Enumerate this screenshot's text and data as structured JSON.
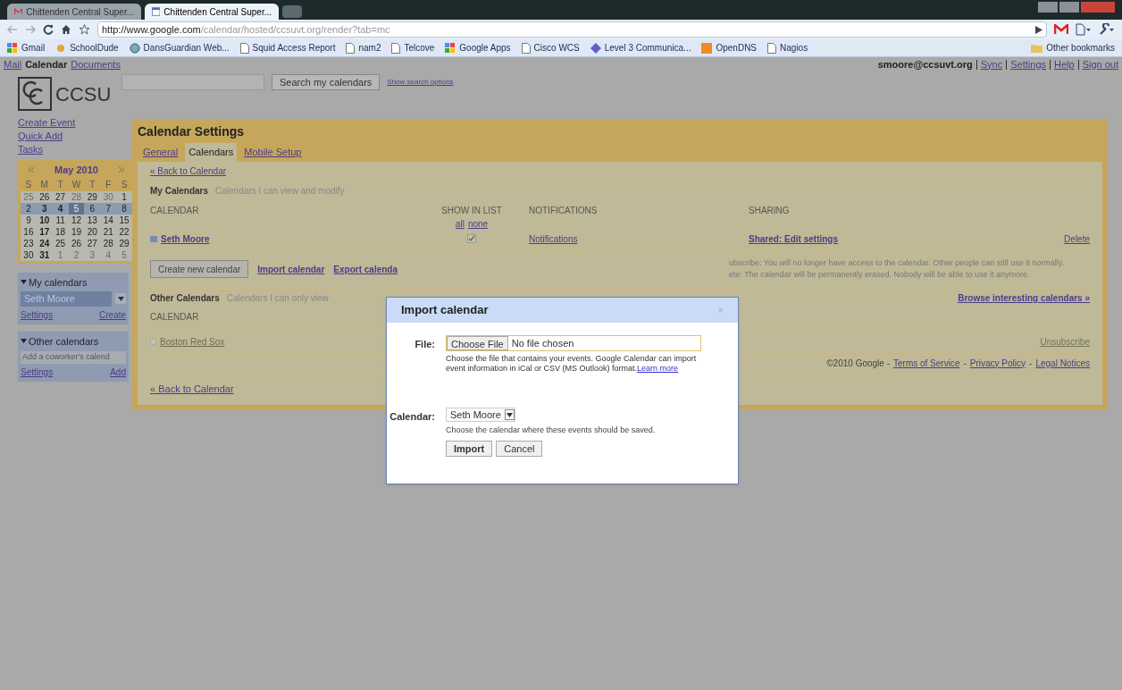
{
  "browser": {
    "tabs": [
      {
        "label": "Chittenden Central Super...",
        "selected": false
      },
      {
        "label": "Chittenden Central Super...",
        "selected": true
      }
    ],
    "url": {
      "host": "http://www.google.com",
      "path": "/calendar/hosted/ccsuvt.org/render?tab=mc"
    },
    "bookmarks": [
      "Gmail",
      "SchoolDude",
      "DansGuardian Web...",
      "Squid Access Report",
      "nam2",
      "Telcove",
      "Google Apps",
      "Cisco WCS",
      "Level 3 Communica...",
      "OpenDNS",
      "Nagios"
    ],
    "other_bookmarks": "Other bookmarks"
  },
  "topbar": {
    "apps": [
      {
        "label": "Mail",
        "selected": false
      },
      {
        "label": "Calendar",
        "selected": true
      },
      {
        "label": "Documents",
        "selected": false
      }
    ],
    "user": "smoore@ccsuvt.org",
    "links": [
      "Sync",
      "Settings",
      "Help",
      "Sign out"
    ]
  },
  "logo": "CCSU",
  "search_button": "Search my calendars",
  "search_options": "Show search options",
  "sidebar": {
    "links": [
      "Create Event",
      "Quick Add",
      "Tasks"
    ],
    "mini_calendar": {
      "month": "May 2010",
      "weekdays": [
        "S",
        "M",
        "T",
        "W",
        "T",
        "F",
        "S"
      ],
      "weeks": [
        {
          "selected": false,
          "days": [
            {
              "d": "25",
              "muted": true,
              "bold": false,
              "selected": false
            },
            {
              "d": "26",
              "muted": false,
              "bold": false,
              "selected": false
            },
            {
              "d": "27",
              "muted": false,
              "bold": false,
              "selected": false
            },
            {
              "d": "28",
              "muted": true,
              "bold": false,
              "selected": false
            },
            {
              "d": "29",
              "muted": false,
              "bold": false,
              "selected": false
            },
            {
              "d": "30",
              "muted": true,
              "bold": false,
              "selected": false
            },
            {
              "d": "1",
              "muted": false,
              "bold": false,
              "selected": false
            }
          ]
        },
        {
          "selected": true,
          "days": [
            {
              "d": "2",
              "muted": false,
              "bold": false,
              "selected": false
            },
            {
              "d": "3",
              "muted": false,
              "bold": true,
              "selected": false
            },
            {
              "d": "4",
              "muted": false,
              "bold": true,
              "selected": false
            },
            {
              "d": "5",
              "muted": false,
              "bold": false,
              "selected": true
            },
            {
              "d": "6",
              "muted": false,
              "bold": false,
              "selected": false
            },
            {
              "d": "7",
              "muted": false,
              "bold": false,
              "selected": false
            },
            {
              "d": "8",
              "muted": false,
              "bold": false,
              "selected": false
            }
          ]
        },
        {
          "selected": false,
          "days": [
            {
              "d": "9",
              "muted": false,
              "bold": false,
              "selected": false
            },
            {
              "d": "10",
              "muted": false,
              "bold": true,
              "selected": false
            },
            {
              "d": "11",
              "muted": false,
              "bold": false,
              "selected": false
            },
            {
              "d": "12",
              "muted": false,
              "bold": false,
              "selected": false
            },
            {
              "d": "13",
              "muted": false,
              "bold": false,
              "selected": false
            },
            {
              "d": "14",
              "muted": false,
              "bold": false,
              "selected": false
            },
            {
              "d": "15",
              "muted": false,
              "bold": false,
              "selected": false
            }
          ]
        },
        {
          "selected": false,
          "days": [
            {
              "d": "16",
              "muted": false,
              "bold": false,
              "selected": false
            },
            {
              "d": "17",
              "muted": false,
              "bold": true,
              "selected": false
            },
            {
              "d": "18",
              "muted": false,
              "bold": false,
              "selected": false
            },
            {
              "d": "19",
              "muted": false,
              "bold": false,
              "selected": false
            },
            {
              "d": "20",
              "muted": false,
              "bold": false,
              "selected": false
            },
            {
              "d": "21",
              "muted": false,
              "bold": false,
              "selected": false
            },
            {
              "d": "22",
              "muted": false,
              "bold": false,
              "selected": false
            }
          ]
        },
        {
          "selected": false,
          "days": [
            {
              "d": "23",
              "muted": false,
              "bold": false,
              "selected": false
            },
            {
              "d": "24",
              "muted": false,
              "bold": true,
              "selected": false
            },
            {
              "d": "25",
              "muted": false,
              "bold": false,
              "selected": false
            },
            {
              "d": "26",
              "muted": false,
              "bold": false,
              "selected": false
            },
            {
              "d": "27",
              "muted": false,
              "bold": false,
              "selected": false
            },
            {
              "d": "28",
              "muted": false,
              "bold": false,
              "selected": false
            },
            {
              "d": "29",
              "muted": false,
              "bold": false,
              "selected": false
            }
          ]
        },
        {
          "selected": false,
          "days": [
            {
              "d": "30",
              "muted": false,
              "bold": false,
              "selected": false
            },
            {
              "d": "31",
              "muted": false,
              "bold": true,
              "selected": false
            },
            {
              "d": "1",
              "muted": true,
              "bold": false,
              "selected": false
            },
            {
              "d": "2",
              "muted": true,
              "bold": false,
              "selected": false
            },
            {
              "d": "3",
              "muted": true,
              "bold": false,
              "selected": false
            },
            {
              "d": "4",
              "muted": true,
              "bold": false,
              "selected": false
            },
            {
              "d": "5",
              "muted": true,
              "bold": false,
              "selected": false
            }
          ]
        }
      ]
    },
    "my_calendars": {
      "title": "My calendars",
      "expanded": true,
      "item": "Seth Moore",
      "links": [
        "Settings",
        "Create"
      ]
    },
    "other_calendars": {
      "title": "Other calendars",
      "expanded": true,
      "placeholder": "Add a coworker's calend",
      "links": [
        "Settings",
        "Add"
      ]
    }
  },
  "settings": {
    "title": "Calendar Settings",
    "tabs": [
      {
        "label": "General",
        "selected": false
      },
      {
        "label": "Calendars",
        "selected": true
      },
      {
        "label": "Mobile Setup",
        "selected": false
      }
    ],
    "back": "« Back to Calendar",
    "my_title": "My Calendars",
    "my_sub": "Calendars I can view and modify",
    "columns": [
      "CALENDAR",
      "SHOW IN LIST",
      "NOTIFICATIONS",
      "SHARING"
    ],
    "show_links": [
      "all",
      "none"
    ],
    "my_rows": [
      {
        "name": "Seth Moore",
        "checked": true,
        "notifications": "Notifications",
        "sharing": "Shared: Edit settings",
        "action": "Delete"
      }
    ],
    "create_button": "Create new calendar",
    "import_link": "Import calendar",
    "export_link": "Export calenda",
    "notes": [
      "ubscribe: You will no longer have access to the calendar. Other people can still use it normally.",
      "ete: The calendar will be permanently erased. Nobody will be able to use it anymore."
    ],
    "other_title": "Other Calendars",
    "other_sub": "Calendars I can only view",
    "other_column": "CALENDAR",
    "browse": "Browse interesting calendars »",
    "other_rows": [
      {
        "name": "Boston Red Sox",
        "checked": false,
        "action": "Unsubscribe"
      }
    ],
    "footer": {
      "copyright": "©2010 Google -",
      "separator": "-",
      "links": [
        "Terms of Service",
        "Privacy Policy",
        "Legal Notices"
      ]
    },
    "back_bottom": "« Back to Calendar"
  },
  "dialog": {
    "title": "Import calendar",
    "close": "×",
    "file_label": "File:",
    "file_button": "Choose File",
    "file_value": "No file chosen",
    "file_help": "Choose the file that contains your events. Google Calendar can import event information in iCal or CSV (MS Outlook) format.",
    "learn_more": "Learn more",
    "calendar_label": "Calendar:",
    "calendar_value": "Seth Moore",
    "calendar_help": "Choose the calendar where these events should be saved.",
    "buttons": [
      {
        "label": "Import",
        "primary": true
      },
      {
        "label": "Cancel",
        "primary": false
      }
    ]
  }
}
